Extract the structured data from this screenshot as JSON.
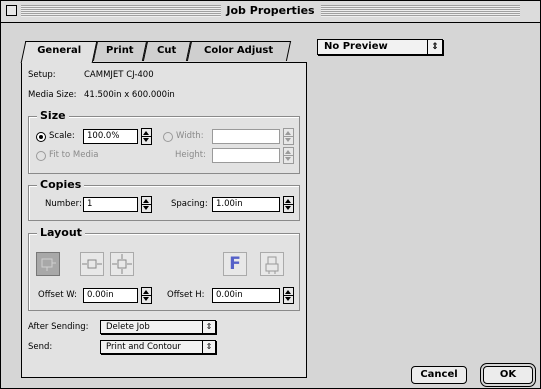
{
  "window": {
    "title": "Job Properties"
  },
  "tabs": [
    {
      "label": "General",
      "active": true
    },
    {
      "label": "Print",
      "active": false
    },
    {
      "label": "Cut",
      "active": false
    },
    {
      "label": "Color Adjust",
      "active": false
    }
  ],
  "preview": {
    "value": "No Preview",
    "arrows": "⇕"
  },
  "general": {
    "setup_label": "Setup:",
    "setup_value": "CAMMJET CJ-400",
    "media_size_label": "Media Size:",
    "media_size_value": "41.500in x 600.000in"
  },
  "size": {
    "title": "Size",
    "scale_label": "Scale:",
    "scale_value": "100.0%",
    "fit_label": "Fit to Media",
    "width_label": "Width:",
    "height_label": "Height:",
    "width_value": "",
    "height_value": ""
  },
  "copies": {
    "title": "Copies",
    "number_label": "Number:",
    "number_value": "1",
    "spacing_label": "Spacing:",
    "spacing_value": "1.00in"
  },
  "layout": {
    "title": "Layout",
    "f_icon": "F",
    "offset_w_label": "Offset W:",
    "offset_w_value": "0.00in",
    "offset_h_label": "Offset H:",
    "offset_h_value": "0.00in"
  },
  "after_sending": {
    "label": "After Sending:",
    "value": "Delete Job",
    "arrows": "⇕"
  },
  "send": {
    "label": "Send:",
    "value": "Print and Contour",
    "arrows": "⇕"
  },
  "buttons": {
    "cancel": "Cancel",
    "ok": "OK"
  }
}
